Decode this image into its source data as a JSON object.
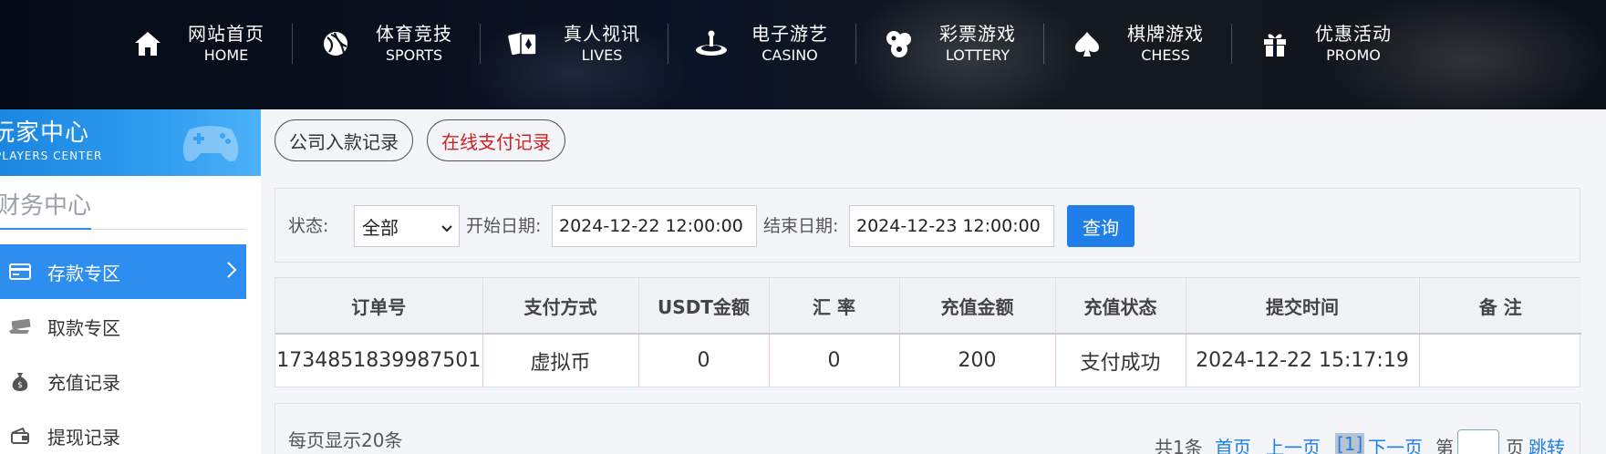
{
  "nav": [
    {
      "zh": "网站首页",
      "en": "HOME",
      "icon": "home-icon"
    },
    {
      "zh": "体育竞技",
      "en": "SPORTS",
      "icon": "ball-icon"
    },
    {
      "zh": "真人视讯",
      "en": "LIVES",
      "icon": "cards-icon"
    },
    {
      "zh": "电子游艺",
      "en": "CASINO",
      "icon": "slot-icon"
    },
    {
      "zh": "彩票游戏",
      "en": "LOTTERY",
      "icon": "lottery-balls-icon"
    },
    {
      "zh": "棋牌游戏",
      "en": "CHESS",
      "icon": "spade-icon"
    },
    {
      "zh": "优惠活动",
      "en": "PROMO",
      "icon": "gift-icon"
    }
  ],
  "sidebar": {
    "banner_title": "玩家中心",
    "banner_subtitle": "PLAYERS CENTER",
    "section_title": "财务中心",
    "items": [
      {
        "label": "存款专区",
        "icon": "card-icon",
        "active": true
      },
      {
        "label": "取款专区",
        "icon": "cash-icon",
        "active": false
      },
      {
        "label": "充值记录",
        "icon": "money-bag-icon",
        "active": false
      },
      {
        "label": "提现记录",
        "icon": "wallet-icon",
        "active": false
      }
    ]
  },
  "tabs": [
    {
      "label": "公司入款记录",
      "active": false
    },
    {
      "label": "在线支付记录",
      "active": true
    }
  ],
  "filter": {
    "status_label": "状态:",
    "status_value": "全部",
    "start_label": "开始日期:",
    "start_value": "2024-12-22 12:00:00",
    "end_label": "结束日期:",
    "end_value": "2024-12-23 12:00:00",
    "query_button": "查询"
  },
  "table": {
    "headers": [
      "订单号",
      "支付方式",
      "USDT金额",
      "汇 率",
      "充值金额",
      "充值状态",
      "提交时间",
      "备 注"
    ],
    "rows": [
      [
        "1734851839987501",
        "虚拟币",
        "0",
        "0",
        "200",
        "支付成功",
        "2024-12-22 15:17:19",
        ""
      ]
    ]
  },
  "pager": {
    "per_page": "每页显示20条",
    "total": "共1条",
    "first": "首页",
    "prev": "上一页",
    "current": "[1]",
    "next": "下一页",
    "goto_prefix": "第",
    "goto_suffix": "页",
    "jump": "跳转"
  },
  "colors": {
    "accent": "#2d8ef0",
    "button": "#1f7ee8",
    "active_tab_text": "#d42020"
  }
}
